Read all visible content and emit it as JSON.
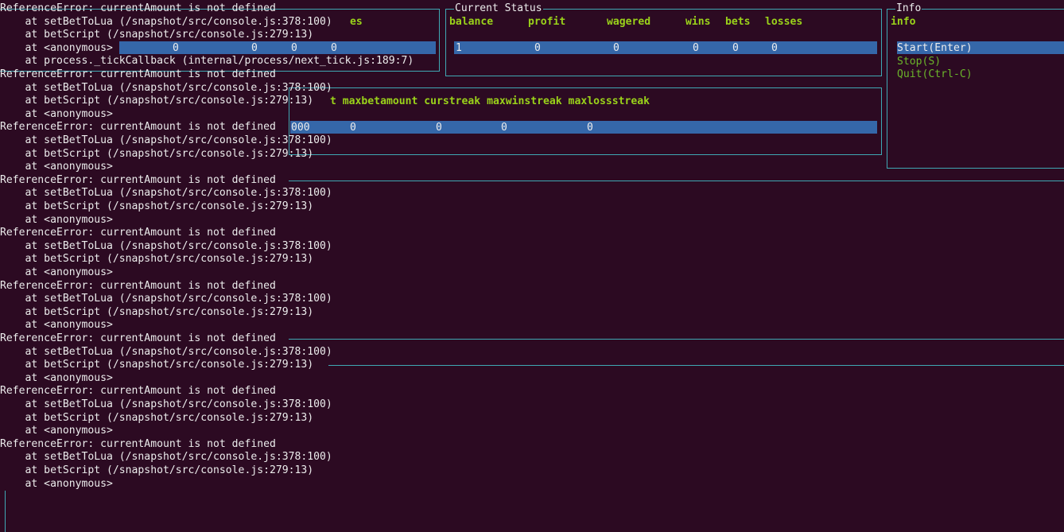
{
  "log": [
    {
      "text": "ReferenceError: currentAmount is not defined"
    },
    {
      "text": "    at setBetToLua (/snapshot/src/console.js:378:100)"
    },
    {
      "text": "    at betScript (/snapshot/src/console.js:279:13)"
    },
    {
      "text": "    at <anonymous>"
    },
    {
      "text": "    at process._tickCallback (internal/process/next_tick.js:189:7)"
    },
    {
      "text": "ReferenceError: currentAmount is not defined"
    },
    {
      "text": "    at setBetToLua (/snapshot/src/console.js:378:100)"
    },
    {
      "text": "    at betScript (/snapshot/src/console.js:279:13)"
    },
    {
      "text": "    at <anonymous>"
    },
    {
      "text": "ReferenceError: currentAmount is not defined"
    },
    {
      "text": "    at setBetToLua (/snapshot/src/console.js:378:100)"
    },
    {
      "text": "    at betScript (/snapshot/src/console.js:279:13)"
    },
    {
      "text": "    at <anonymous>"
    },
    {
      "text": "ReferenceError: currentAmount is not defined"
    },
    {
      "text": "    at setBetToLua (/snapshot/src/console.js:378:100)"
    },
    {
      "text": "    at betScript (/snapshot/src/console.js:279:13)"
    },
    {
      "text": "    at <anonymous>"
    },
    {
      "text": "ReferenceError: currentAmount is not defined"
    },
    {
      "text": "    at setBetToLua (/snapshot/src/console.js:378:100)"
    },
    {
      "text": "    at betScript (/snapshot/src/console.js:279:13)"
    },
    {
      "text": "    at <anonymous>"
    },
    {
      "text": "ReferenceError: currentAmount is not defined"
    },
    {
      "text": "    at setBetToLua (/snapshot/src/console.js:378:100)"
    },
    {
      "text": "    at betScript (/snapshot/src/console.js:279:13)"
    },
    {
      "text": "    at <anonymous>"
    },
    {
      "text": "ReferenceError: currentAmount is not defined"
    },
    {
      "text": "    at setBetToLua (/snapshot/src/console.js:378:100)"
    },
    {
      "text": "    at betScript (/snapshot/src/console.js:279:13)"
    },
    {
      "text": "    at <anonymous>"
    },
    {
      "text": "ReferenceError: currentAmount is not defined"
    },
    {
      "text": "    at setBetToLua (/snapshot/src/console.js:378:100)"
    },
    {
      "text": "    at betScript (/snapshot/src/console.js:279:13)"
    },
    {
      "text": "    at <anonymous>"
    },
    {
      "text": "ReferenceError: currentAmount is not defined"
    },
    {
      "text": "    at setBetToLua (/snapshot/src/console.js:378:100)"
    },
    {
      "text": "    at betScript (/snapshot/src/console.js:279:13)"
    },
    {
      "text": "    at <anonymous>"
    }
  ],
  "first_panel": {
    "header_tail": "es",
    "row_values": [
      "0",
      "0",
      "0",
      "0"
    ]
  },
  "status_panel": {
    "title": "Current Status",
    "headers": [
      "balance",
      "profit",
      "wagered",
      "wins",
      "bets",
      "losses"
    ],
    "values": [
      "1",
      "0",
      "0",
      "0",
      "0",
      "0"
    ]
  },
  "stats_panel": {
    "header_tail": "t maxbetamount curstreak maxwinstreak maxlossstreak",
    "row_prefix": "000",
    "row_values": [
      "0",
      "0",
      "0",
      "0"
    ]
  },
  "info_panel": {
    "title": "Info",
    "header": "info",
    "menu": [
      {
        "label": "Start(Enter)",
        "selected": true
      },
      {
        "label": "Stop(S)",
        "selected": false
      },
      {
        "label": "Quit(Ctrl-C)",
        "selected": false
      }
    ]
  },
  "colors": {
    "background": "#2c0a22",
    "text": "#ececec",
    "accent_green": "#9ad21a",
    "highlight": "#3567a9",
    "border": "#3fa8b4"
  }
}
